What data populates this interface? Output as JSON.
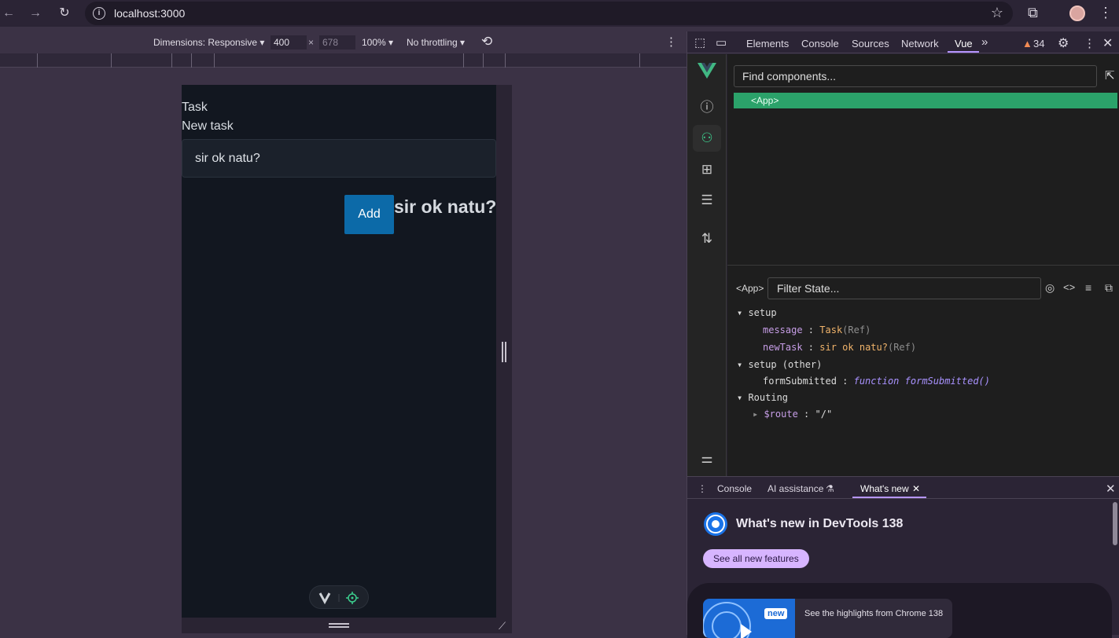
{
  "browser": {
    "url": "localhost:3000"
  },
  "device_toolbar": {
    "dimensions_label": "Dimensions: Responsive",
    "width": "400",
    "times": "×",
    "height": "678",
    "zoom": "100%",
    "throttling": "No throttling"
  },
  "app": {
    "message": "Task",
    "new_task_label": "New task",
    "input_value": "sir ok natu?",
    "add_button": "Add",
    "echo": "sir ok natu?"
  },
  "devtools": {
    "tabs": [
      "Elements",
      "Console",
      "Sources",
      "Network",
      "Vue"
    ],
    "more": "»",
    "issues_count": "34",
    "vue": {
      "find_placeholder": "Find components...",
      "selected_component": "<App>",
      "state_component": "<App>",
      "filter_placeholder": "Filter State...",
      "sections": {
        "setup": "setup",
        "setup_other": "setup (other)",
        "routing": "Routing"
      },
      "state": {
        "message_key": "message",
        "message_val": "Task",
        "message_type": "(Ref)",
        "newtask_key": "newTask",
        "newtask_val": "sir ok natu?",
        "newtask_type": "(Ref)",
        "fn_key": "formSubmitted",
        "fn_kw": "function",
        "fn_name": "formSubmitted()",
        "route_key": "$route",
        "route_val": "\"/\""
      }
    }
  },
  "drawer": {
    "tabs": [
      "Console",
      "AI assistance",
      "What's new"
    ],
    "title": "What's new in DevTools 138",
    "see_all": "See all new features",
    "badge": "new",
    "highlight": "See the highlights from Chrome 138"
  },
  "colors": {
    "vue_green": "#2ba26a",
    "accent_purple": "#b695ff",
    "add_button_blue": "#0c6aa8",
    "warning_orange": "#f28b54"
  }
}
